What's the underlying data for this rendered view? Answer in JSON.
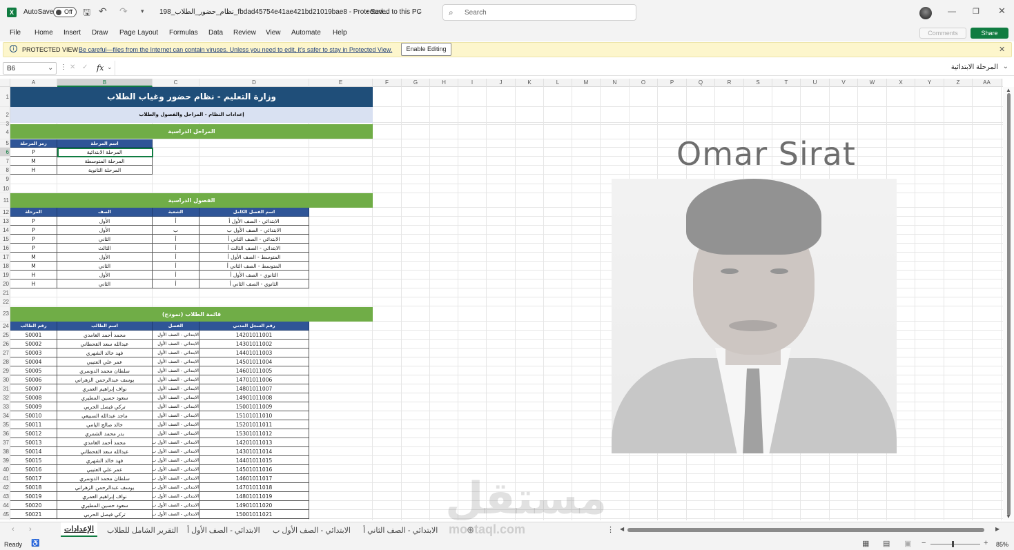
{
  "titlebar": {
    "autosave": "AutoSave",
    "toggle": "Off",
    "filename": "نظام_حضور_الطلاب_198_fbdad45754e41ae421bd21019bae8 - Protected...",
    "saved": "• Saved to this PC",
    "search_placeholder": "Search"
  },
  "ribbon": {
    "tabs": [
      "File",
      "Home",
      "Insert",
      "Draw",
      "Page Layout",
      "Formulas",
      "Data",
      "Review",
      "View",
      "Automate",
      "Help"
    ],
    "comments": "Comments",
    "share": "Share"
  },
  "protected": {
    "label": "PROTECTED VIEW",
    "message": "Be careful—files from the Internet can contain viruses. Unless you need to edit, it's safer to stay in Protected View.",
    "button": "Enable Editing"
  },
  "formula": {
    "namebox": "B6",
    "fx": "fx",
    "value": "المرحلة الابتدائية"
  },
  "columns": [
    "A",
    "B",
    "C",
    "D",
    "E",
    "F",
    "G",
    "H",
    "I",
    "J",
    "K",
    "L",
    "M",
    "N",
    "O",
    "P",
    "Q",
    "R",
    "S",
    "T",
    "U",
    "V",
    "W",
    "X",
    "Y",
    "Z",
    "AA"
  ],
  "rows": [
    "1",
    "2",
    "3",
    "4",
    "5",
    "6",
    "7",
    "8",
    "9",
    "10",
    "11",
    "12",
    "13",
    "14",
    "15",
    "16",
    "17",
    "18",
    "19",
    "20",
    "21",
    "22",
    "23",
    "24",
    "25",
    "26",
    "27",
    "28",
    "29",
    "30",
    "31",
    "32",
    "33",
    "34",
    "35",
    "36",
    "37",
    "38",
    "39",
    "40",
    "41",
    "42",
    "43",
    "44",
    "45"
  ],
  "sheet": {
    "title": "وزارة التعليم - نظام حضور وغياب الطلاب",
    "subtitle": "إعدادات النظام - المراحل والفصول والطلاب",
    "stages_title": "المراحل الدراسية",
    "stages_headers": [
      "رمز المرحلة",
      "اسم المرحلة"
    ],
    "stages": [
      [
        "P",
        "المرحلة الابتدائية"
      ],
      [
        "M",
        "المرحلة المتوسطة"
      ],
      [
        "H",
        "المرحلة الثانوية"
      ]
    ],
    "classes_title": "الفصول الدراسية",
    "classes_headers": [
      "المرحلة",
      "الصف",
      "الشعبة",
      "اسم الفصل الكامل"
    ],
    "classes": [
      [
        "P",
        "الأول",
        "أ",
        "الابتدائي - الصف الأول أ"
      ],
      [
        "P",
        "الأول",
        "ب",
        "الابتدائي - الصف الأول ب"
      ],
      [
        "P",
        "الثاني",
        "أ",
        "الابتدائي - الصف الثاني أ"
      ],
      [
        "P",
        "الثالث",
        "أ",
        "الابتدائي - الصف الثالث أ"
      ],
      [
        "M",
        "الأول",
        "أ",
        "المتوسط - الصف الأول أ"
      ],
      [
        "M",
        "الثاني",
        "أ",
        "المتوسط - الصف الثاني أ"
      ],
      [
        "H",
        "الأول",
        "أ",
        "الثانوي - الصف الأول أ"
      ],
      [
        "H",
        "الثاني",
        "أ",
        "الثانوي - الصف الثاني أ"
      ]
    ],
    "students_title": "قائمة الطلاب (نموذج)",
    "students_headers": [
      "رقم الطالب",
      "اسم الطالب",
      "الفصل",
      "رقم السجل المدني"
    ],
    "students": [
      [
        "S0001",
        "محمد أحمد الغامدي",
        "الابتدائي - الصف الأول",
        "14201011001"
      ],
      [
        "S0002",
        "عبدالله سعد القحطاني",
        "الابتدائي - الصف الأول",
        "14301011002"
      ],
      [
        "S0003",
        "فهد خالد الشهري",
        "الابتدائي - الصف الأول",
        "14401011003"
      ],
      [
        "S0004",
        "عمر علي العتيبي",
        "الابتدائي - الصف الأول",
        "14501011004"
      ],
      [
        "S0005",
        "سلطان محمد الدوسري",
        "الابتدائي - الصف الأول",
        "14601011005"
      ],
      [
        "S0006",
        "يوسف عبدالرحمن الزهراني",
        "الابتدائي - الصف الأول",
        "14701011006"
      ],
      [
        "S0007",
        "نواف إبراهيم العمري",
        "الابتدائي - الصف الأول",
        "14801011007"
      ],
      [
        "S0008",
        "سعود حسين المطيري",
        "الابتدائي - الصف الأول",
        "14901011008"
      ],
      [
        "S0009",
        "تركي فيصل الحربي",
        "الابتدائي - الصف الأول",
        "15001011009"
      ],
      [
        "S0010",
        "ماجد عبدالله السبيعي",
        "الابتدائي - الصف الأول",
        "15101011010"
      ],
      [
        "S0011",
        "خالد صالح اليامي",
        "الابتدائي - الصف الأول",
        "15201011011"
      ],
      [
        "S0012",
        "بدر محمد الشمري",
        "الابتدائي - الصف الأول",
        "15301011012"
      ],
      [
        "S0013",
        "محمد أحمد الغامدي",
        "الابتدائي - الصف الأول ب",
        "14201011013"
      ],
      [
        "S0014",
        "عبدالله سعد القحطاني",
        "الابتدائي - الصف الأول ب",
        "14301011014"
      ],
      [
        "S0015",
        "فهد خالد الشهري",
        "الابتدائي - الصف الأول ب",
        "14401011015"
      ],
      [
        "S0016",
        "عمر علي العتيبي",
        "الابتدائي - الصف الأول ب",
        "14501011016"
      ],
      [
        "S0017",
        "سلطان محمد الدوسري",
        "الابتدائي - الصف الأول ب",
        "14601011017"
      ],
      [
        "S0018",
        "يوسف عبدالرحمن الزهراني",
        "الابتدائي - الصف الأول ب",
        "14701011018"
      ],
      [
        "S0019",
        "نواف إبراهيم العمري",
        "الابتدائي - الصف الأول ب",
        "14801011019"
      ],
      [
        "S0020",
        "سعود حسين المطيري",
        "الابتدائي - الصف الأول ب",
        "14901011020"
      ],
      [
        "S0021",
        "تركي فيصل الحربي",
        "الابتدائي - الصف الأول ب",
        "15001011021"
      ]
    ],
    "photo_name": "Omar Sirat"
  },
  "tabs": {
    "active": "الإعدادات",
    "items": [
      "التقرير الشامل للطلاب",
      "الابتدائي - الصف الأول أ",
      "الابتدائي - الصف الأول ب",
      "الابتدائي - الصف الثاني أ"
    ]
  },
  "watermark": {
    "arabic": "مستقل",
    "latin": "mostaql.com"
  },
  "status": {
    "ready": "Ready",
    "zoom": "85%"
  },
  "colors": {
    "excel_green": "#107c41",
    "title_blue": "#1f4e79",
    "section_green": "#70ad47",
    "header_blue": "#2f5597",
    "subtitle_bg": "#d9e1f2"
  }
}
